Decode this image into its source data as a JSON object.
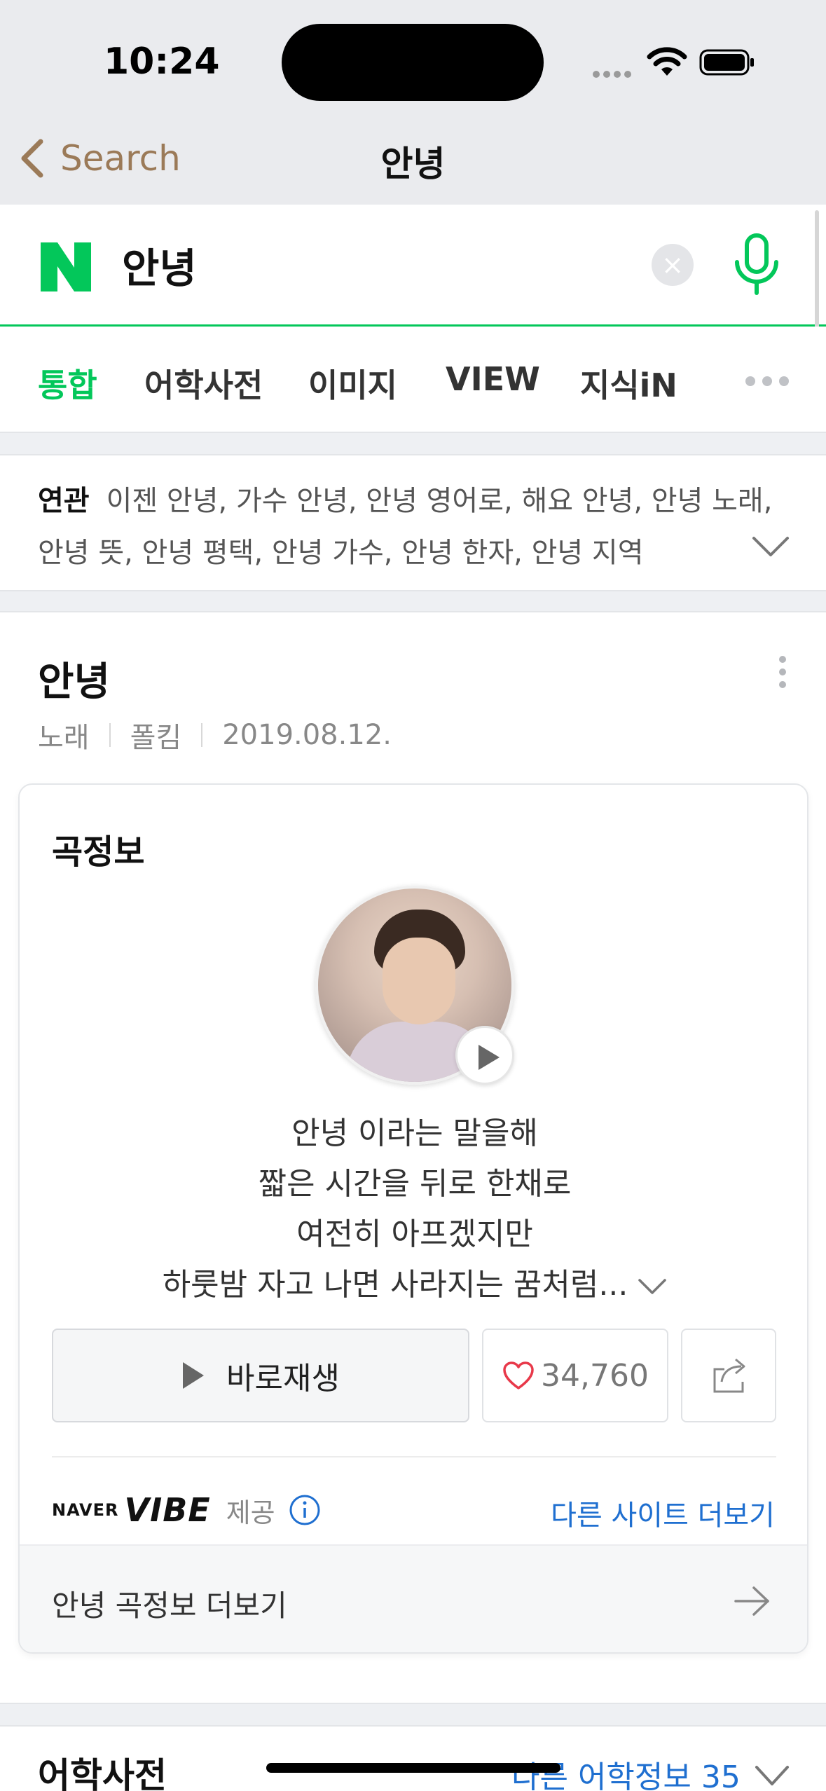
{
  "status_bar": {
    "time": "10:24"
  },
  "nav": {
    "back_label": "Search",
    "title": "안녕"
  },
  "search": {
    "query": "안녕",
    "clear_symbol": "×"
  },
  "tabs": [
    {
      "label": "통합",
      "active": true
    },
    {
      "label": "어학사전",
      "active": false
    },
    {
      "label": "이미지",
      "active": false
    },
    {
      "label": "VIEW",
      "active": false
    },
    {
      "label": "지식iN",
      "active": false
    }
  ],
  "related": {
    "label": "연관",
    "line1": "이젠 안녕, 가수 안녕, 안녕 영어로, 해요 안녕, 안녕 노래,",
    "line2": "안녕 뜻, 안녕 평택, 안녕 가수, 안녕 한자, 안녕 지역"
  },
  "song": {
    "title": "안녕",
    "meta": [
      "노래",
      "폴킴",
      "2019.08.12."
    ],
    "card_title": "곡정보",
    "lyrics": [
      "안녕 이라는 말을해",
      "짧은 시간을 뒤로 한채로",
      "여전히 아프겠지만",
      "하룻밤 자고 나면 사라지는 꿈처럼..."
    ],
    "play_label": "바로재생",
    "like_count": "34,760",
    "provider_naver": "NAVER",
    "provider_vibe": "VIBE",
    "provider_suffix": "제공",
    "other_sites": "다른 사이트 더보기",
    "more_label": "안녕 곡정보 더보기"
  },
  "dictionary": {
    "title": "어학사전",
    "more": "다른 어학정보 35"
  },
  "colors": {
    "accent_green": "#03c75a",
    "link_blue": "#1f6fd0",
    "back_brown": "#9b7a58",
    "heart_red": "#e8394a"
  },
  "icons": [
    "back-chevron-icon",
    "naver-n-logo",
    "clear-icon",
    "mic-icon",
    "more-dots-icon",
    "chevron-down-icon",
    "kebab-icon",
    "play-icon",
    "heart-icon",
    "share-icon",
    "info-icon",
    "arrow-right-icon"
  ]
}
